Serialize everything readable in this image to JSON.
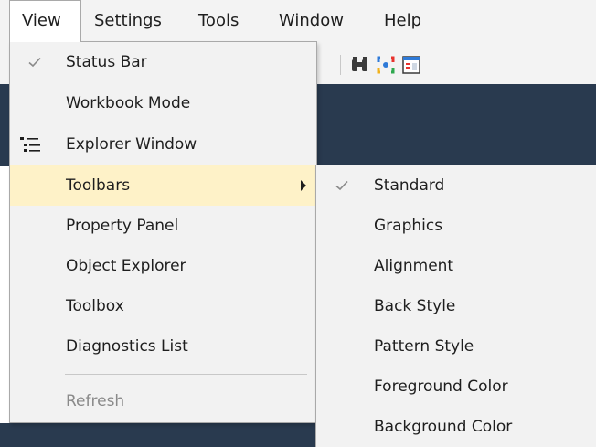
{
  "menubar": {
    "items": [
      {
        "label": "View",
        "open": true
      },
      {
        "label": "Settings"
      },
      {
        "label": "Tools"
      },
      {
        "label": "Window"
      },
      {
        "label": "Help"
      }
    ]
  },
  "toolbar": {
    "icons": [
      "binoculars-icon",
      "circular-arrows-icon",
      "window-panel-icon"
    ]
  },
  "view_menu": {
    "items": [
      {
        "label": "Status Bar",
        "checked": true,
        "icon": "checkmark-icon"
      },
      {
        "label": "Workbook Mode"
      },
      {
        "label": "Explorer Window",
        "icon": "tree-list-icon"
      },
      {
        "label": "Toolbars",
        "highlighted": true,
        "has_submenu": true
      },
      {
        "label": "Property Panel"
      },
      {
        "label": "Object Explorer"
      },
      {
        "label": "Toolbox"
      },
      {
        "label": "Diagnostics List"
      },
      {
        "label": "Refresh",
        "disabled": true
      }
    ]
  },
  "toolbars_submenu": {
    "items": [
      {
        "label": "Standard",
        "checked": true,
        "icon": "checkmark-icon"
      },
      {
        "label": "Graphics"
      },
      {
        "label": "Alignment"
      },
      {
        "label": "Back Style"
      },
      {
        "label": "Pattern Style"
      },
      {
        "label": "Foreground Color"
      },
      {
        "label": "Background Color"
      }
    ]
  },
  "colors": {
    "menubar_bg": "#f3f3f3",
    "menu_bg": "#f2f2f2",
    "highlight": "#fef2c8",
    "dark_band": "#293a4f",
    "disabled_text": "#8a8a8a"
  }
}
